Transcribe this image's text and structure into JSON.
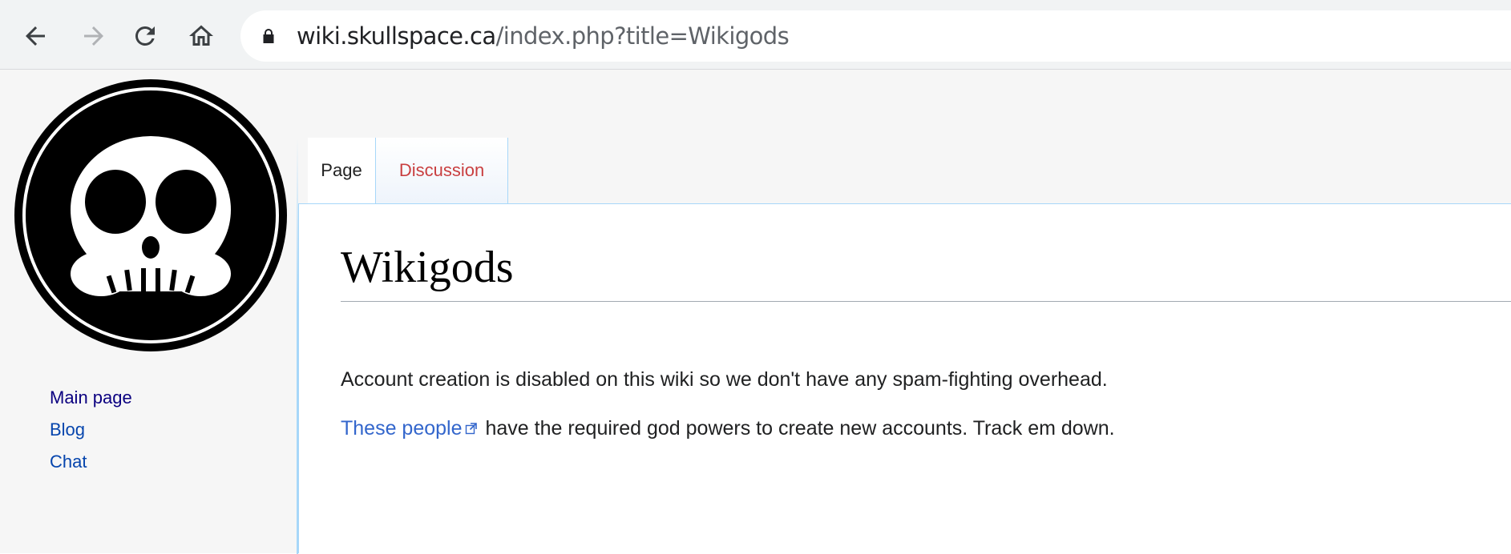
{
  "browser": {
    "url_host": "wiki.skullspace.ca",
    "url_path": "/index.php?title=Wikigods",
    "icons": [
      "back-arrow-icon",
      "forward-arrow-icon",
      "reload-icon",
      "home-icon",
      "lock-icon"
    ]
  },
  "sidebar": {
    "logo": "skull-logo",
    "items": [
      {
        "label": "Main page"
      },
      {
        "label": "Blog"
      },
      {
        "label": "Chat"
      }
    ]
  },
  "tabs": [
    {
      "label": "Page"
    },
    {
      "label": "Discussion"
    }
  ],
  "article": {
    "title": "Wikigods",
    "paragraph1": "Account creation is disabled on this wiki so we don't have any spam-fighting overhead.",
    "link_text": "These people",
    "paragraph2_rest": " have the required god powers to create new accounts. Track em down."
  },
  "colors": {
    "link": "#0645ad",
    "visited_link": "#0b0080",
    "external_link": "#3366cc",
    "new_link": "#ba0000",
    "border": "#a7d7f9"
  }
}
